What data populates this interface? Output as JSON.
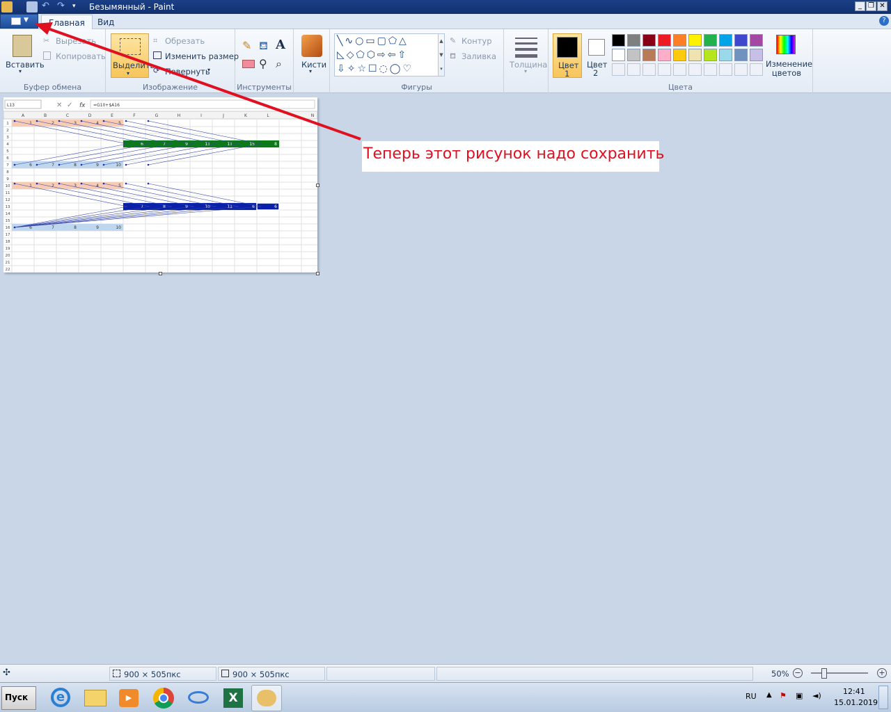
{
  "window": {
    "title": "Безымянный - Paint"
  },
  "tabs": [
    "Главная",
    "Вид"
  ],
  "ribbon": {
    "clipboard": {
      "paste": "Вставить",
      "cut": "Вырезать",
      "copy": "Копировать",
      "label": "Буфер обмена"
    },
    "image": {
      "select": "Выделить",
      "crop": "Обрезать",
      "resize": "Изменить размер",
      "rotate": "Повернуть",
      "label": "Изображение"
    },
    "tools": {
      "label": "Инструменты"
    },
    "brushes": {
      "label": "Кисти"
    },
    "shapes": {
      "outline": "Контур",
      "fill": "Заливка",
      "label": "Фигуры"
    },
    "size": {
      "label": "Толщина"
    },
    "color1": {
      "label": "Цвет",
      "num": "1"
    },
    "color2": {
      "label": "Цвет",
      "num": "2"
    },
    "colors": {
      "label": "Цвета",
      "edit": "Изменение цветов",
      "palette_row1": [
        "#000000",
        "#7f7f7f",
        "#880015",
        "#ed1c24",
        "#ff7f27",
        "#fff200",
        "#22b14c",
        "#00a2e8",
        "#3f48cc",
        "#a349a4"
      ],
      "palette_row2": [
        "#ffffff",
        "#c3c3c3",
        "#b97a57",
        "#ffaec9",
        "#ffc90e",
        "#efe4b0",
        "#b5e61d",
        "#99d9ea",
        "#7092be",
        "#c8bfe7"
      ]
    }
  },
  "callout": "Теперь этот  рисунок надо сохранить",
  "sheet": {
    "namebox": "L13",
    "formula": "=G10+$A16",
    "columns": [
      "A",
      "B",
      "C",
      "D",
      "E",
      "F",
      "G",
      "H",
      "I",
      "J",
      "K",
      "L",
      "N"
    ],
    "rows": [
      "1",
      "2",
      "3",
      "4",
      "5",
      "6",
      "7",
      "8",
      "9",
      "10",
      "11",
      "12",
      "13",
      "14",
      "15",
      "16",
      "17",
      "18",
      "19",
      "20",
      "21",
      "22"
    ],
    "r1": [
      "1",
      "2",
      "3",
      "4",
      "5"
    ],
    "r4": [
      "6",
      "7",
      "9",
      "11",
      "11",
      "15",
      "8",
      "8"
    ],
    "r7": [
      "6",
      "7",
      "8",
      "9",
      "10"
    ],
    "r10": [
      "1",
      "2",
      "3",
      "4",
      "5"
    ],
    "r13": [
      "7",
      "8",
      "9",
      "10",
      "11",
      "6",
      "6"
    ],
    "r16": [
      "6",
      "7",
      "8",
      "9",
      "10"
    ]
  },
  "status": {
    "size1": "900 × 505пкс",
    "size2": "900 × 505пкс",
    "zoom": "50%"
  },
  "taskbar": {
    "start": "Пуск",
    "lang": "RU",
    "time": "12:41",
    "date": "15.01.2019"
  }
}
